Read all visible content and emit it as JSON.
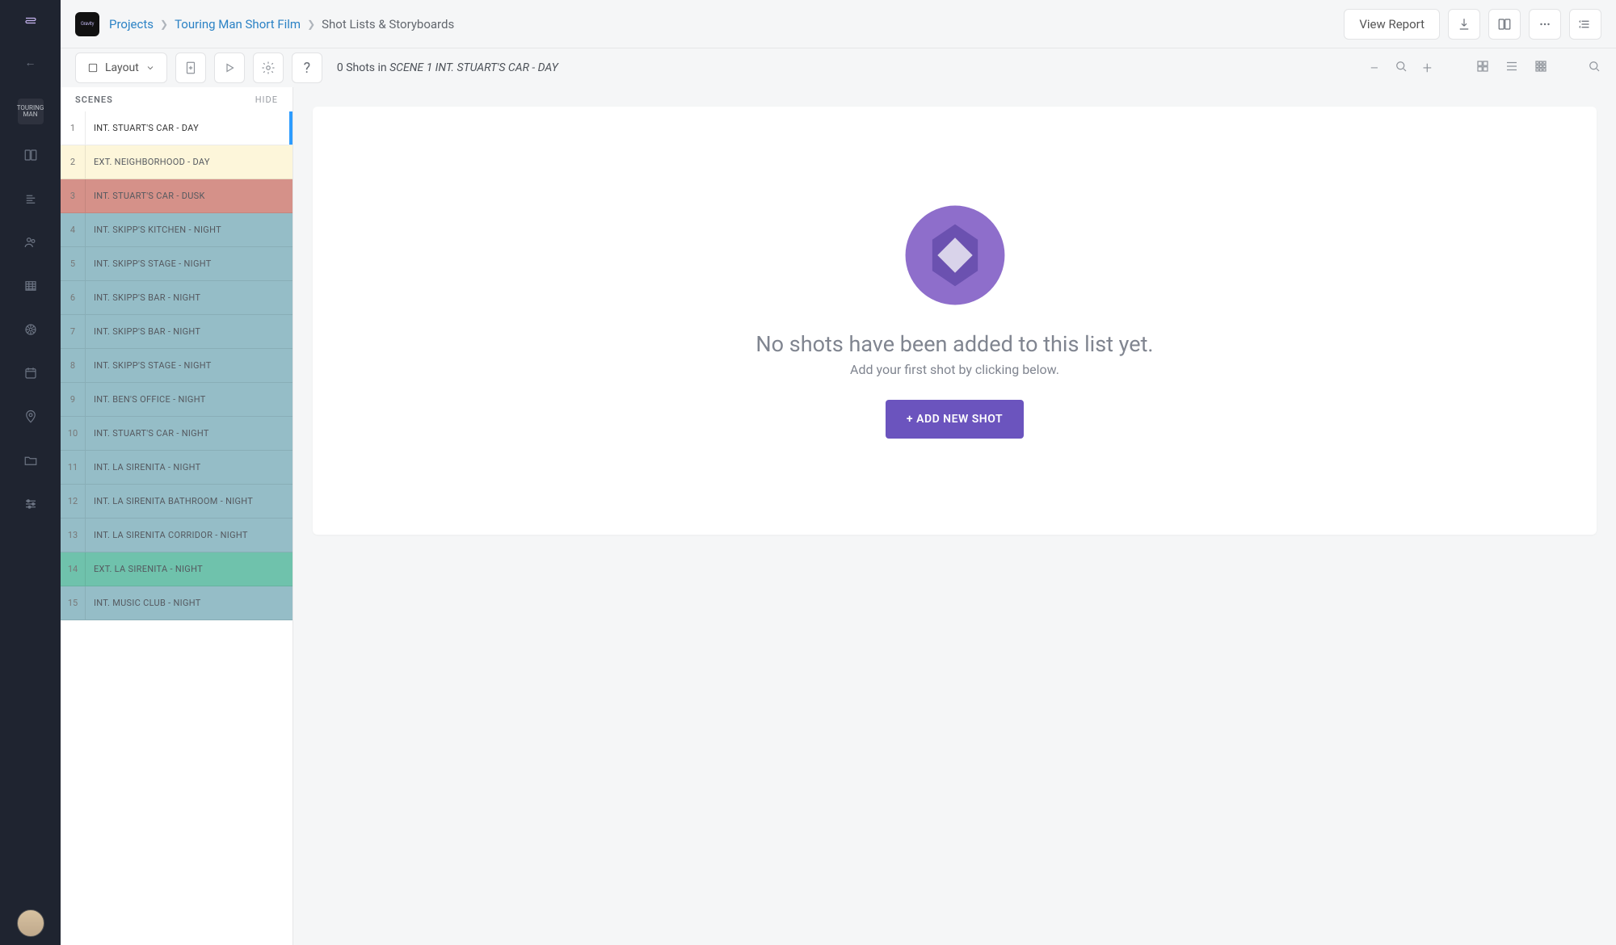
{
  "colors": {
    "accent_blue": "#2d9cff",
    "accent_purple": "#6b54be"
  },
  "breadcrumb": {
    "project_chip": "Gravity",
    "projects_label": "Projects",
    "project_name": "Touring Man Short Film",
    "current": "Shot Lists & Storyboards"
  },
  "header_actions": {
    "view_report": "View Report"
  },
  "layout_dropdown": {
    "label": "Layout"
  },
  "shot_count": {
    "prefix": "0 Shots in ",
    "scene": "SCENE 1 INT. STUART'S CAR - DAY"
  },
  "scenes_panel": {
    "title": "SCENES",
    "hide": "HIDE",
    "items": [
      {
        "num": "1",
        "name": "INT. STUART'S CAR - DAY",
        "bg": "#ffffff",
        "active": true
      },
      {
        "num": "2",
        "name": "EXT. NEIGHBORHOOD - DAY",
        "bg": "#fdf6da"
      },
      {
        "num": "3",
        "name": "INT. STUART'S CAR - DUSK",
        "bg": "#d59189"
      },
      {
        "num": "4",
        "name": "INT. SKIPP'S KITCHEN - NIGHT",
        "bg": "#95bdc7"
      },
      {
        "num": "5",
        "name": "INT. SKIPP'S STAGE - NIGHT",
        "bg": "#95bdc7"
      },
      {
        "num": "6",
        "name": "INT. SKIPP'S BAR - NIGHT",
        "bg": "#95bdc7"
      },
      {
        "num": "7",
        "name": "INT. SKIPP'S BAR - NIGHT",
        "bg": "#95bdc7"
      },
      {
        "num": "8",
        "name": "INT. SKIPP'S STAGE - NIGHT",
        "bg": "#95bdc7"
      },
      {
        "num": "9",
        "name": "INT. BEN'S OFFICE - NIGHT",
        "bg": "#95bdc7"
      },
      {
        "num": "10",
        "name": "INT. STUART'S CAR - NIGHT",
        "bg": "#95bdc7"
      },
      {
        "num": "11",
        "name": "INT. LA SIRENITA - NIGHT",
        "bg": "#95bdc7"
      },
      {
        "num": "12",
        "name": "INT. LA SIRENITA BATHROOM - NIGHT",
        "bg": "#95bdc7"
      },
      {
        "num": "13",
        "name": "INT. LA SIRENITA CORRIDOR - NIGHT",
        "bg": "#95bdc7"
      },
      {
        "num": "14",
        "name": "EXT. LA SIRENITA - NIGHT",
        "bg": "#6fc2ac"
      },
      {
        "num": "15",
        "name": "INT. MUSIC CLUB - NIGHT",
        "bg": "#95bdc7"
      }
    ]
  },
  "empty_state": {
    "title": "No shots have been added to this list yet.",
    "sub": "Add your first shot by clicking below.",
    "button": "+ ADD NEW SHOT"
  },
  "rail_items": [
    "project-thumb",
    "storyboard",
    "script",
    "cast",
    "breakdown",
    "reports-wheel",
    "calendar",
    "locations",
    "files",
    "settings-sliders"
  ]
}
